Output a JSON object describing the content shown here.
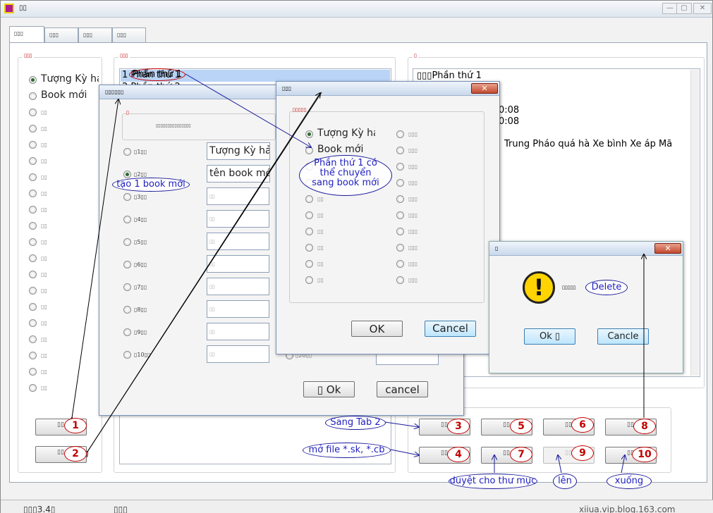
{
  "title": "▯▯",
  "tabs": [
    "▯▯▯",
    "▯▯▯",
    "▯▯▯",
    "▯▯▯"
  ],
  "g1": {
    "title": "▯▯▯",
    "items": [
      "Tượng Kỳ hả",
      "Book mới"
    ],
    "placeholder": "▯▯"
  },
  "g2": {
    "title": "▯▯▯",
    "list": [
      "1 Phần thứ 1",
      "2 Phần thứ 2"
    ]
  },
  "g3": {
    "title": "▯",
    "lines": [
      "▯▯▯Phần thứ 1",
      "0:08",
      "0:08",
      "Trung Pháo quá hà Xe bình Xe áp Mã"
    ]
  },
  "buttons": {
    "b": "▯▯"
  },
  "d1": {
    "title": "▯▯▯▯▯▯",
    "hint": "▯▯▯▯▯▯▯▯▯▯▯▯▯▯▯",
    "label": "▯",
    "rows": [
      "▯1▯▯",
      "▯2▯▯",
      "▯3▯▯",
      "▯4▯▯",
      "▯5▯▯",
      "▯6▯▯",
      "▯7▯▯",
      "▯8▯▯",
      "▯9▯▯",
      "▯10▯▯"
    ],
    "values": [
      "Tượng Kỳ hả",
      "tên book mới"
    ],
    "ph": "▯▯",
    "ok": "▯ Ok",
    "cancel": "cancel",
    "row20": "▯20▯▯"
  },
  "d2": {
    "title": "▯▯▯",
    "group": "▯▯▯▯▯",
    "items": [
      "Tượng Kỳ hả",
      "Book mới"
    ],
    "ph": "▯▯",
    "ph2": "▯▯▯",
    "ok": "OK",
    "cancel": "Cancel"
  },
  "d3": {
    "title": "▯",
    "msg": "▯▯▯▯▯",
    "delete": "Delete",
    "ok": "Ok ▯",
    "cancel": "Cancle",
    "x": "✕"
  },
  "annotations": {
    "tao": "tạo 1 book mới",
    "phan": "Phần thứ 1",
    "phan_full": "Phần thứ 1 có\nthể chuyển\nsang book mới",
    "sangtab": "Sang Tab 2",
    "mofile": "mở file *.sk, *.cb",
    "duyet": "duyệt cho thư mục",
    "len": "lên",
    "xuong": "xuống",
    "nums": [
      "1",
      "2",
      "3",
      "4",
      "5",
      "6",
      "7",
      "8",
      "9",
      "10"
    ]
  },
  "status": {
    "left": "▯▯▯3.4▯",
    "mid": "▯▯▯",
    "right": "xiiua.vip.blog.163.com"
  },
  "caption": {
    "min": "—",
    "max": "▢",
    "close": "✕"
  }
}
